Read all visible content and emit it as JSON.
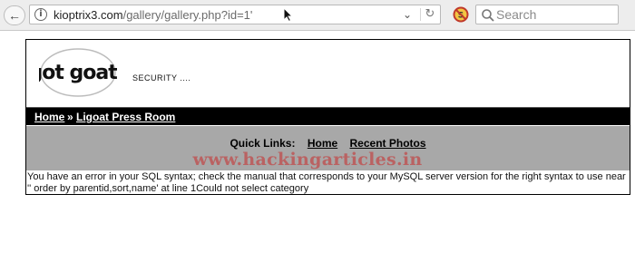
{
  "browser": {
    "url_host": "kioptrix3.com",
    "url_path": "/gallery/gallery.php?id=1'",
    "search_placeholder": "Search",
    "icons": {
      "back": "back-arrow-icon",
      "site_info": "info-icon",
      "cursor": "mouse-cursor-icon",
      "dropdown": "chevron-down-icon",
      "reload": "reload-icon",
      "addon": "no-script-addon-icon",
      "search": "search-icon"
    }
  },
  "site": {
    "logo_text": "got goat?",
    "tagline": "SECURITY ....",
    "nav": {
      "home": "Home",
      "separator": "»",
      "current": "Ligoat Press Room"
    },
    "quick_links": {
      "label": "Quick Links:",
      "items": [
        "Home",
        "Recent Photos"
      ]
    },
    "watermark": "www.hackingarticles.in",
    "error_message": "You have an error in your SQL syntax; check the manual that corresponds to your MySQL server version for the right syntax to use near '' order by parentid,sort,name' at line 1Could not select category"
  },
  "colors": {
    "navbar_bg": "#000000",
    "quicklinks_bg": "#a8a8a8",
    "watermark": "#c82828",
    "toolbar_bg": "#ededed"
  }
}
